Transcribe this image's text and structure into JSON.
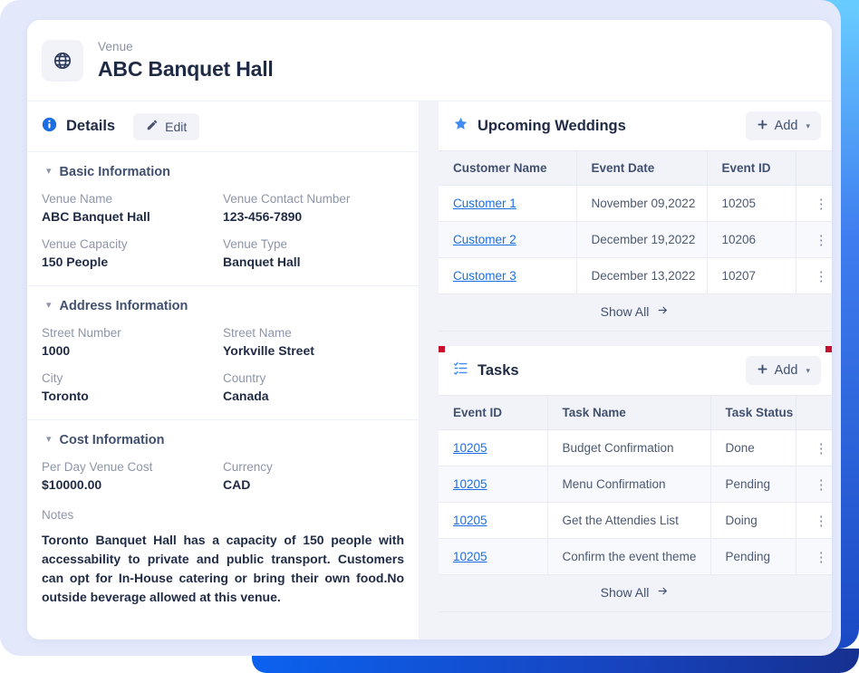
{
  "theme": {
    "accent_blue": "#1b6fe0",
    "star_blue": "#3f8cf5",
    "text_dark": "#1f2a44",
    "text_muted": "#8d95a8",
    "surface": "#ffffff",
    "panel_bg": "#f1f3f8",
    "page_bg": "#e4e8fb",
    "selection_marker": "#c8102e"
  },
  "header": {
    "icon": "globe-icon",
    "kicker": "Venue",
    "title": "ABC Banquet Hall"
  },
  "details": {
    "icon": "info-circle-icon",
    "title": "Details",
    "edit_button": {
      "label": "Edit",
      "icon": "pencil-icon"
    },
    "sections": [
      {
        "title": "Basic Information",
        "chevron": "chevron-down-icon",
        "fields": [
          {
            "label": "Venue Name",
            "value": "ABC Banquet Hall"
          },
          {
            "label": "Venue Contact Number",
            "value": "123-456-7890"
          },
          {
            "label": "Venue Capacity",
            "value": "150 People"
          },
          {
            "label": "Venue Type",
            "value": "Banquet Hall"
          }
        ]
      },
      {
        "title": "Address Information",
        "chevron": "chevron-down-icon",
        "fields": [
          {
            "label": "Street Number",
            "value": "1000"
          },
          {
            "label": "Street Name",
            "value": "Yorkville Street"
          },
          {
            "label": "City",
            "value": "Toronto"
          },
          {
            "label": "Country",
            "value": "Canada"
          }
        ]
      },
      {
        "title": "Cost Information",
        "chevron": "chevron-down-icon",
        "fields": [
          {
            "label": "Per Day Venue Cost",
            "value": "$10000.00"
          },
          {
            "label": "Currency",
            "value": "CAD"
          }
        ],
        "notes_label": "Notes",
        "notes_value": "Toronto Banquet Hall has a capacity of 150 people with accessability to private and public transport. Customers can opt for In-House catering or bring their own food.No outside beverage allowed at this venue."
      }
    ]
  },
  "weddings": {
    "icon": "star-icon",
    "title": "Upcoming Weddings",
    "add_button": {
      "label": "Add",
      "icon": "plus-icon",
      "caret": "caret-down-icon"
    },
    "columns": [
      "Customer Name",
      "Event Date",
      "Event ID",
      ""
    ],
    "rows": [
      {
        "customer": "Customer 1",
        "date": "November 09,2022",
        "event_id": "10205",
        "menu": "kebab-menu-icon"
      },
      {
        "customer": "Customer 2",
        "date": "December 19,2022",
        "event_id": "10206",
        "menu": "kebab-menu-icon"
      },
      {
        "customer": "Customer 3",
        "date": "December 13,2022",
        "event_id": "10207",
        "menu": "kebab-menu-icon"
      }
    ],
    "footer": {
      "label": "Show All",
      "icon": "arrow-right-icon"
    }
  },
  "tasks": {
    "icon": "checklist-icon",
    "title": "Tasks",
    "selected": true,
    "add_button": {
      "label": "Add",
      "icon": "plus-icon",
      "caret": "caret-down-icon"
    },
    "columns": [
      "Event ID",
      "Task Name",
      "Task Status",
      ""
    ],
    "rows": [
      {
        "event_id": "10205",
        "task_name": "Budget Confirmation",
        "status": "Done",
        "menu": "kebab-menu-icon"
      },
      {
        "event_id": "10205",
        "task_name": "Menu Confirmation",
        "status": "Pending",
        "menu": "kebab-menu-icon"
      },
      {
        "event_id": "10205",
        "task_name": "Get the Attendies List",
        "status": "Doing",
        "menu": "kebab-menu-icon"
      },
      {
        "event_id": "10205",
        "task_name": "Confirm the event theme",
        "status": "Pending",
        "menu": "kebab-menu-icon"
      }
    ],
    "footer": {
      "label": "Show All",
      "icon": "arrow-right-icon"
    }
  }
}
